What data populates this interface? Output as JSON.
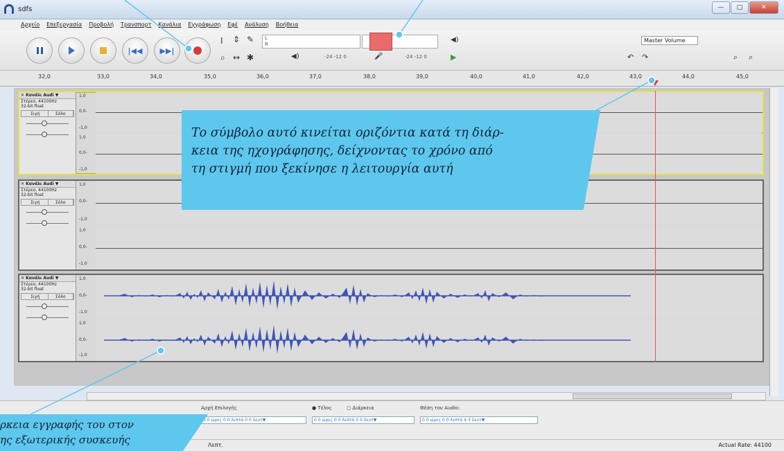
{
  "window": {
    "title": "sdfs",
    "buttons": {
      "minimize": "—",
      "maximize": "□",
      "close": "✕"
    }
  },
  "menu": [
    "Αρχείο",
    "Επεξεργασία",
    "Προβολή",
    "Τρανσπορτ",
    "Κανάλια",
    "Εγγράφωση",
    "Εφέ",
    "Ανάλυση",
    "Βοήθεια"
  ],
  "meters": {
    "left_label": "L",
    "right_label": "R",
    "scale_a": "-24 -12 0",
    "scale_b": "-24 -12 0",
    "volume_label": "Master Volume"
  },
  "ruler": [
    "32,0",
    "33,0",
    "34,0",
    "35,0",
    "36,0",
    "37,0",
    "38,0",
    "39,0",
    "40,0",
    "41,0",
    "42,0",
    "43,0",
    "44,0",
    "45,0"
  ],
  "tracks": [
    {
      "name": "Κανάλι Audi",
      "info1": "Στέρεο, 44100Hz",
      "info2": "32-bit float",
      "mute": "Σιγή",
      "solo": "Σόλο",
      "scale_top": "1,0",
      "scale_mid": "0,0-",
      "scale_bot": "-1,0"
    },
    {
      "name": "Κανάλι Audi",
      "info1": "Στέρεο, 44100Hz",
      "info2": "32-bit float",
      "mute": "Σιγή",
      "solo": "Σόλο",
      "scale_top": "1,0",
      "scale_mid": "0,0-",
      "scale_bot": "-1,0"
    },
    {
      "name": "Κανάλι Audi",
      "info1": "Στέρεο, 44100Hz",
      "info2": "32-bit float",
      "mute": "Σιγή",
      "solo": "Σόλο",
      "scale_top": "1,0",
      "scale_mid": "0,0-",
      "scale_bot": "-1,0"
    }
  ],
  "selection": {
    "start_label": "Αρχή Επιλογής",
    "end_label": "Τέλος",
    "length_label": "Διάρκεια",
    "audio_pos_label": "Θέση του Audio:",
    "field1": "0 0 ώρες 0 0 λεπτά 0 0 δευτ▼",
    "field2": "0 0 ώρες 0 0 λεπτά 0 0 δευτ▼",
    "field3": "0 0 ώρες 0 0 λεπτά 4 3 δευτ▼"
  },
  "status": {
    "left": "Λεπτ.",
    "right": "Actual Rate: 44100"
  },
  "callout_main": [
    "Το σύμβολο αυτό κινείται οριζόντια κατά τη διάρ-",
    "κεια της ηχογράφησης, δείχνοντας το χρόνο από",
    "τη στιγμή που ξεκίνησε η λειτουργία αυτή"
  ],
  "callout_bottom": [
    "ρκεια εγγραφής του στον",
    "ης εξωτερικής συσκευής"
  ],
  "colors": {
    "callout": "#5ec7ee",
    "waveform": "#3e55b8",
    "record": "#d63b3b",
    "meter_red": "#e86a6a"
  }
}
